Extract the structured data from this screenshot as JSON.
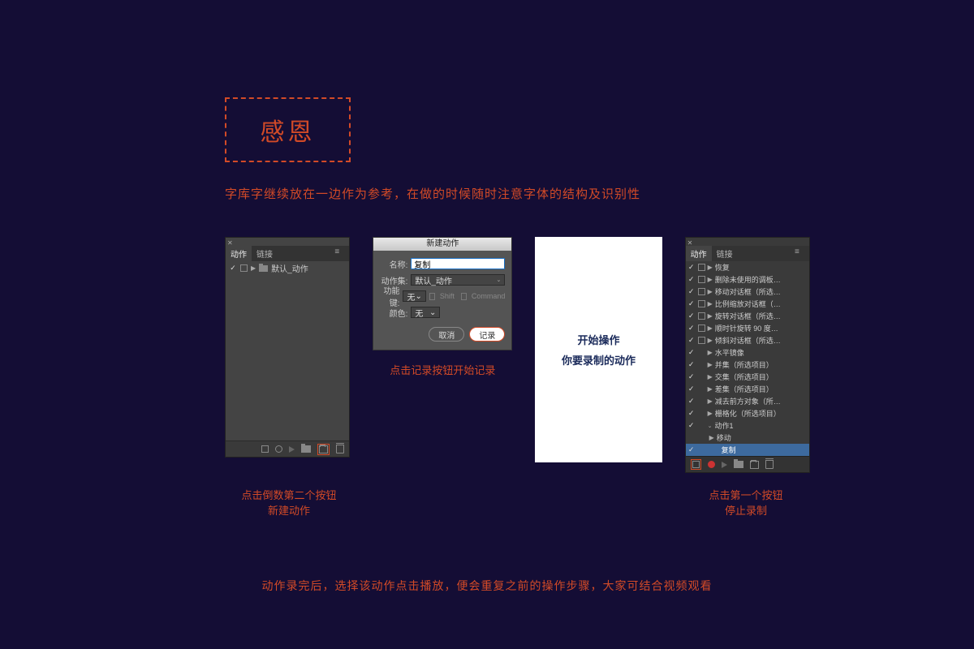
{
  "header": {
    "boxed_text": "感恩",
    "subtitle": "字库字继续放在一边作为参考，在做的时候随时注意字体的结构及识别性"
  },
  "panel1": {
    "tab_active": "动作",
    "tab_inactive": "链接",
    "row_text": "默认_动作",
    "caption_line1": "点击倒数第二个按钮",
    "caption_line2": "新建动作"
  },
  "dialog": {
    "title": "新建动作",
    "name_label": "名称:",
    "name_value": "复制",
    "set_label": "动作集:",
    "set_value": "默认_动作",
    "fkey_label": "功能键:",
    "fkey_value": "无",
    "shift_label": "Shift",
    "command_label": "Command",
    "color_label": "颜色:",
    "color_value": "无",
    "cancel": "取消",
    "record": "记录",
    "caption": "点击记录按钮开始记录"
  },
  "white_panel": {
    "line1": "开始操作",
    "line2": "你要录制的动作"
  },
  "panel4": {
    "tab_active": "动作",
    "tab_inactive": "链接",
    "items": [
      "恢复",
      "删除未使用的调板…",
      "移动对话框（所选…",
      "比例缩放对话框（…",
      "旋转对话框（所选…",
      "顺时针旋转 90 度…",
      "倾斜对话框（所选…",
      "水平镜像",
      "并集（所选项目）",
      "交集（所选项目）",
      "差集（所选项目）",
      "减去前方对象（所…",
      "栅格化（所选项目）"
    ],
    "group": "动作1",
    "sub": "移动",
    "highlighted": "复制",
    "caption_line1": "点击第一个按钮",
    "caption_line2": "停止录制"
  },
  "footer_text": "动作录完后，选择该动作点击播放，便会重复之前的操作步骤，大家可结合视频观看"
}
